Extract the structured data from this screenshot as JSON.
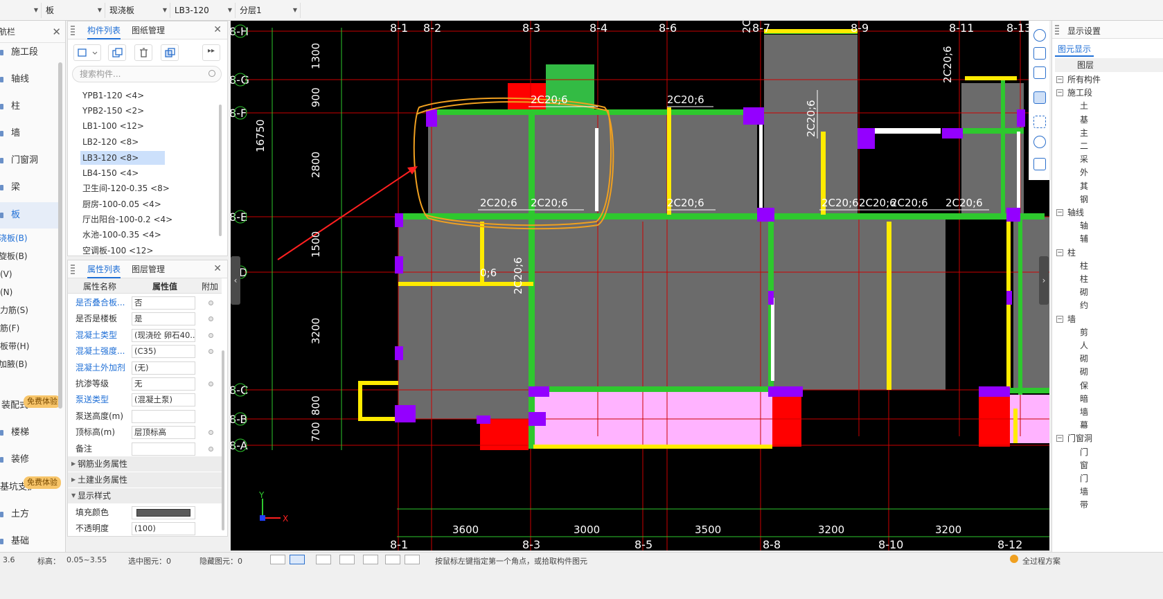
{
  "topbar": {
    "selectors": [
      "",
      "板",
      "现浇板",
      "LB3-120",
      "分层1"
    ]
  },
  "nav": {
    "title": "导航栏",
    "items": [
      {
        "label": "施工段"
      },
      {
        "label": "轴线"
      },
      {
        "label": "柱"
      },
      {
        "label": "墙"
      },
      {
        "label": "门窗洞"
      },
      {
        "label": "梁"
      },
      {
        "label": "板"
      }
    ],
    "subitems": [
      "现浇板(B)",
      "螺旋板(B)",
      "柱帽(V)",
      "板洞(N)",
      "板受力筋(S)",
      "板负筋(F)",
      "楼层板带(H)",
      "板加腋(B)"
    ],
    "lower": [
      {
        "label": "装配式",
        "badge": "免费体验"
      },
      {
        "label": "楼梯"
      },
      {
        "label": "装修"
      },
      {
        "label": "基坑支护",
        "badge": "免费体验"
      },
      {
        "label": "土方"
      },
      {
        "label": "基础"
      }
    ]
  },
  "components": {
    "tabs": [
      "构件列表",
      "图纸管理"
    ],
    "search_placeholder": "搜索构件...",
    "items": [
      "YPB1-120 <4>",
      "YPB2-150 <2>",
      "LB1-100 <12>",
      "LB2-120 <8>",
      "LB3-120 <8>",
      "LB4-150 <4>",
      "卫生间-120-0.35 <8>",
      "厨房-100-0.05 <4>",
      "厅出阳台-100-0.2 <4>",
      "水池-100-0.35 <4>",
      "空调板-100 <12>"
    ],
    "selected": "LB3-120 <8>"
  },
  "properties": {
    "tabs": [
      "属性列表",
      "图层管理"
    ],
    "columns": [
      "属性名称",
      "属性值",
      "附加"
    ],
    "rows": [
      {
        "name": "是否叠合板...",
        "value": "否",
        "blue": true,
        "dot": true
      },
      {
        "name": "是否是楼板",
        "value": "是",
        "blue": false,
        "dot": true
      },
      {
        "name": "混凝土类型",
        "value": "(现浇砼 卵石40...",
        "blue": true,
        "dot": true
      },
      {
        "name": "混凝土强度...",
        "value": "(C35)",
        "blue": true,
        "dot": true
      },
      {
        "name": "混凝土外加剂",
        "value": "(无)",
        "blue": true,
        "dot": false
      },
      {
        "name": "抗渗等级",
        "value": "无",
        "blue": false,
        "dot": true
      },
      {
        "name": "泵送类型",
        "value": "(混凝土泵)",
        "blue": true,
        "dot": false
      },
      {
        "name": "泵送高度(m)",
        "value": "",
        "blue": false,
        "dot": false
      },
      {
        "name": "顶标高(m)",
        "value": "层顶标高",
        "blue": false,
        "dot": true
      },
      {
        "name": "备注",
        "value": "",
        "blue": false,
        "dot": true
      }
    ],
    "groups": [
      "钢筋业务属性",
      "土建业务属性",
      "显示样式"
    ],
    "style_rows": [
      {
        "name": "填充颜色",
        "value": ""
      },
      {
        "name": "不透明度",
        "value": "(100)"
      }
    ]
  },
  "drawing": {
    "axes_x_top": [
      "8-1",
      "8-2",
      "8-3",
      "8-4",
      "8-6",
      "8-7",
      "8-9",
      "8-11",
      "8-13"
    ],
    "axes_x_bottom": [
      "8-1",
      "8-3",
      "8-5",
      "8-8",
      "8-10",
      "8-12"
    ],
    "axes_y": [
      "8-H",
      "8-G",
      "8-F",
      "8-E",
      "D",
      "8-C",
      "8-B",
      "8-A"
    ],
    "dims_left": [
      "1300",
      "900",
      "2800",
      "1500",
      "3200",
      "800",
      "700"
    ],
    "dim_total": "16750",
    "dims_bottom": [
      "3600",
      "3000",
      "3500",
      "3200",
      "3200"
    ],
    "rebar_labels": [
      "2C20;6",
      "2C20;6",
      "2C20;6",
      "2C20;6",
      "2C20;6",
      "2C20;6",
      "2C20;6",
      "2C20;6",
      "2C20;6",
      "2C20;6",
      "2C20;6",
      "2C20;6",
      "2C20;6"
    ],
    "rebar_short": [
      "0;6",
      "2C20;6"
    ],
    "axis_label_x": "X",
    "axis_label_y": "Y"
  },
  "right_panel": {
    "title": "显示设置",
    "tabs": [
      "图元显示"
    ],
    "header": "图层",
    "rows": [
      "所有构件",
      "施工段",
      "土",
      "基",
      "主",
      "二",
      "采",
      "外",
      "其",
      "钢",
      "轴线",
      "轴",
      "辅",
      "柱",
      "柱",
      "柱",
      "砌",
      "约",
      "墙",
      "剪",
      "人",
      "砌",
      "砌",
      "保",
      "暗",
      "墙",
      "幕",
      "门窗洞",
      "门",
      "窗",
      "门",
      "墙",
      "带"
    ]
  },
  "status": {
    "items": [
      "3.6",
      "标高：",
      "0.05~3.55",
      "选中图元：0",
      "隐藏图元：0"
    ],
    "hint": "按鼠标左键指定第一个角点，或拾取构件图元",
    "right": "全过程方案"
  },
  "colors": {
    "wall_green": "#2ec82e",
    "beam_yellow": "#ffeb00",
    "column_purple": "#9400ff",
    "slab_gray": "#6b6b6b",
    "axis_red": "#cc0000",
    "accent": "#1f6fd6"
  }
}
